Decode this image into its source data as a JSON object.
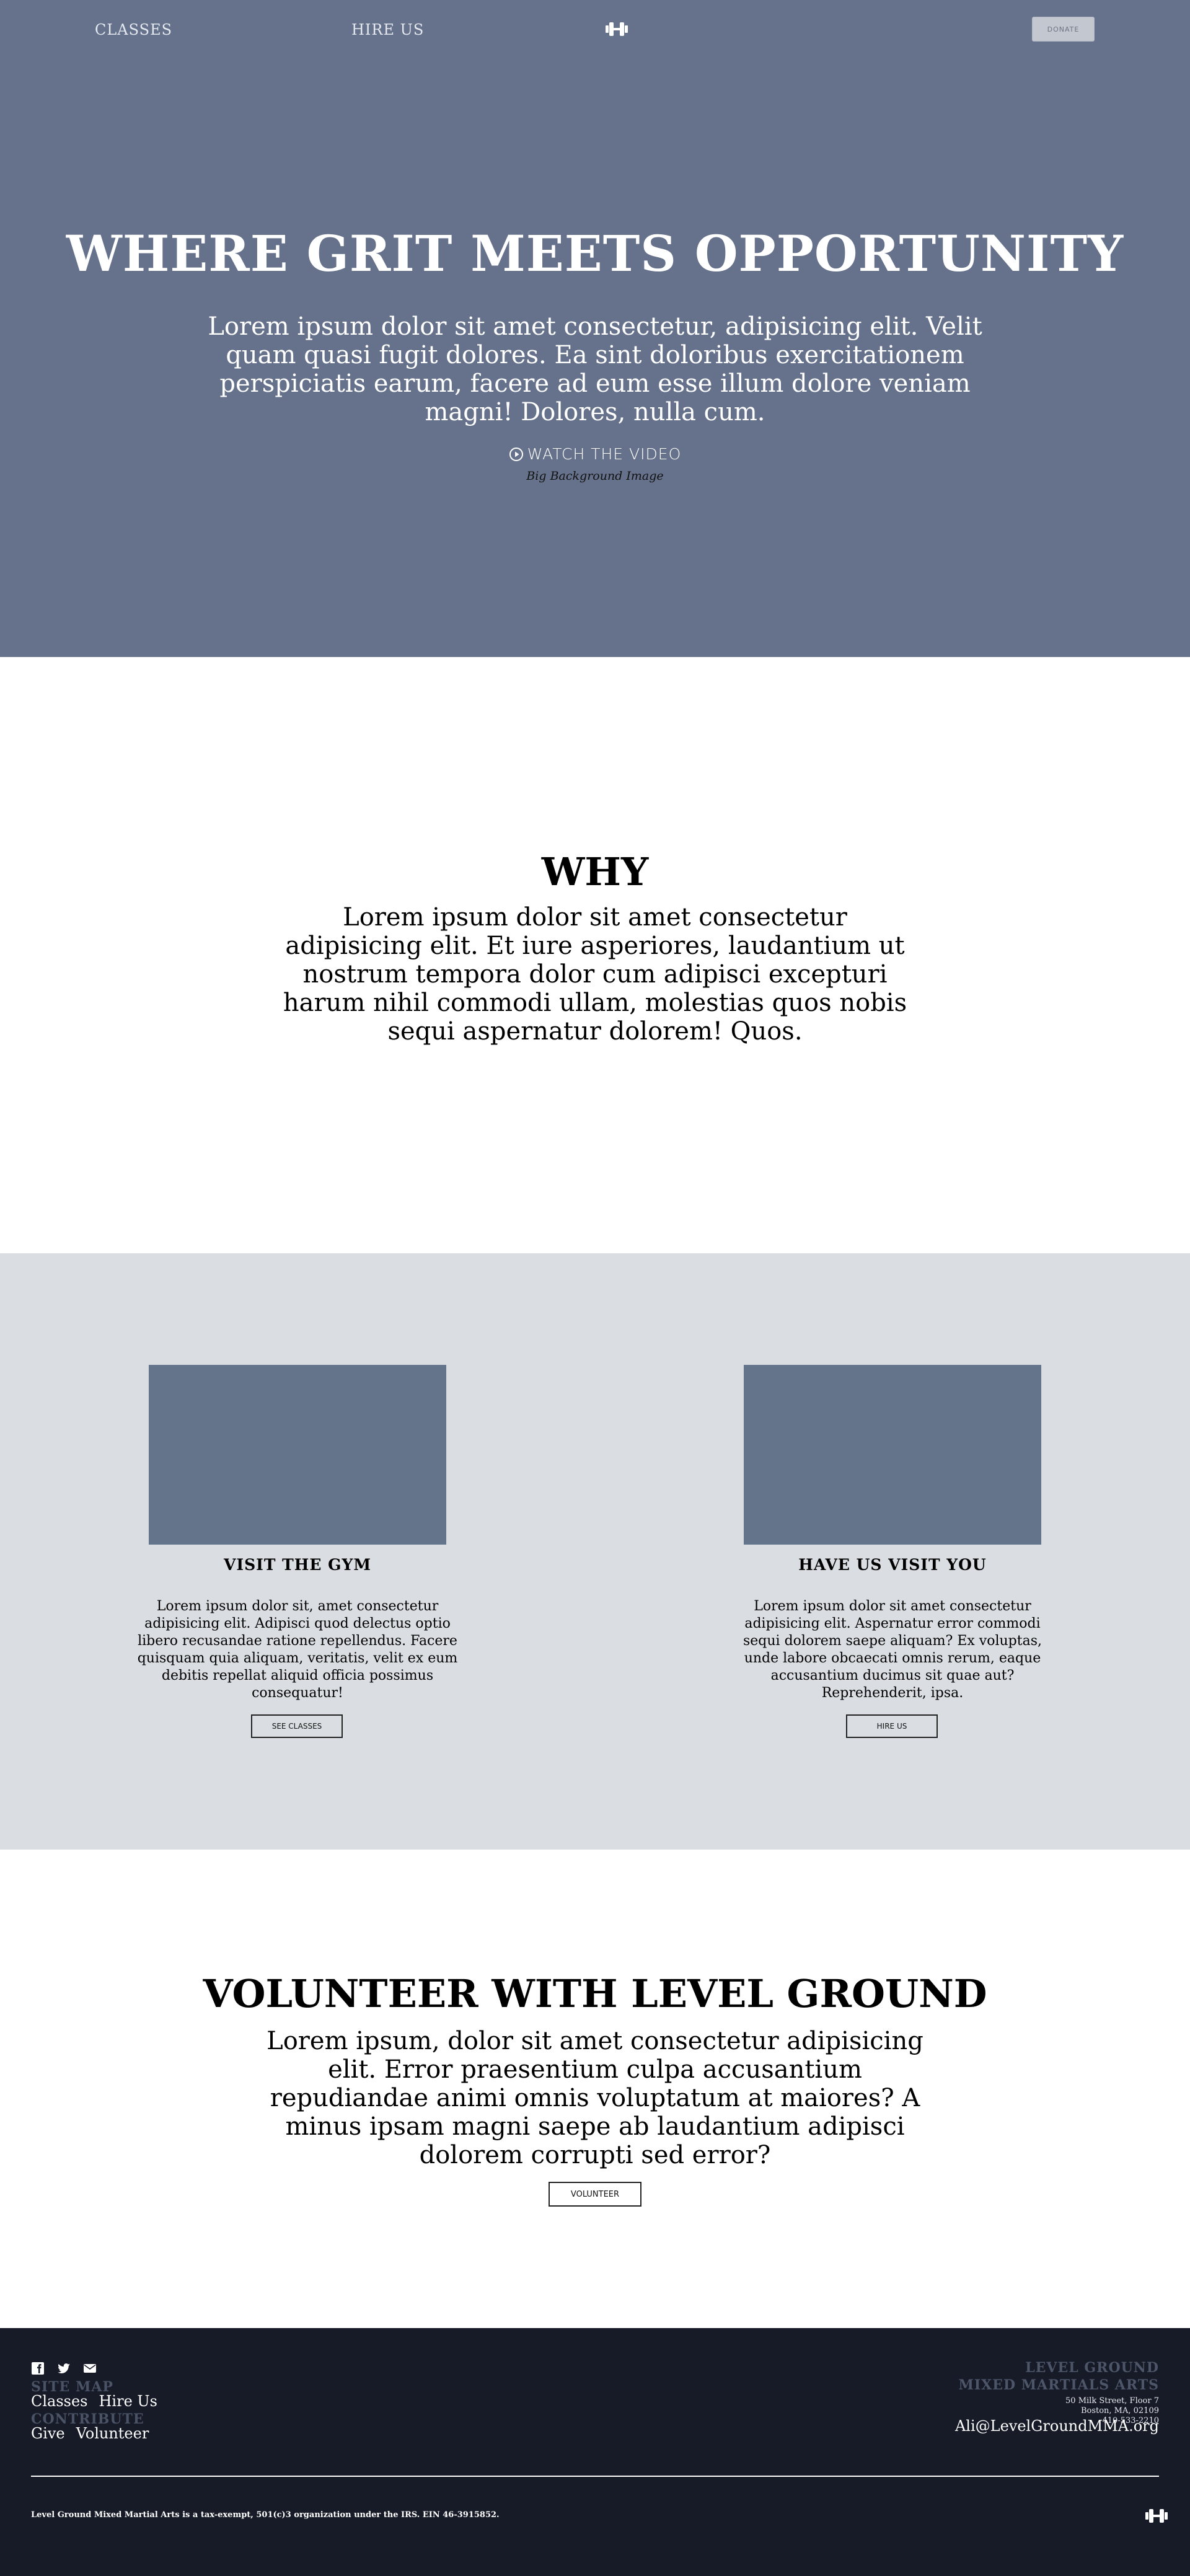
{
  "nav": {
    "classes": "CLASSES",
    "hire_us": "HIRE US",
    "donate": "DONATE",
    "logo_icon": "dumbbell-icon"
  },
  "hero": {
    "title": "WHERE GRIT MEETS OPPORTUNITY",
    "text": "Lorem ipsum dolor sit amet consectetur, adipisicing elit. Velit quam quasi fugit dolores. Ea sint doloribus exercitationem perspiciatis earum, facere ad eum esse illum dolore veniam magni! Dolores, nulla cum.",
    "watch_video": "WATCH THE VIDEO",
    "caption": "Big Background Image",
    "background_color": "#66728b"
  },
  "why": {
    "title": "WHY",
    "text": "Lorem ipsum dolor sit amet consectetur adipisicing elit. Et iure asperiores, laudantium ut nostrum tempora dolor cum adipisci excepturi harum nihil commodi ullam, molestias quos nobis sequi aspernatur dolorem! Quos."
  },
  "cards": [
    {
      "title": "VISIT THE GYM",
      "text": "Lorem ipsum dolor sit, amet consectetur adipisicing elit. Adipisci quod delectus optio libero recusandae ratione repellendus. Facere quisquam quia aliquam, veritatis, velit ex eum debitis repellat aliquid officia possimus consequatur!",
      "button": "SEE CLASSES"
    },
    {
      "title": "HAVE US VISIT YOU",
      "text": "Lorem ipsum dolor sit amet consectetur adipisicing elit. Aspernatur error commodi sequi dolorem saepe aliquam? Ex voluptas, unde labore obcaecati omnis rerum, eaque accusantium ducimus sit quae aut? Reprehenderit, ipsa.",
      "button": "HIRE US"
    }
  ],
  "volunteer": {
    "title": "VOLUNTEER WITH LEVEL GROUND",
    "text": "Lorem ipsum, dolor sit amet consectetur adipisicing elit. Error praesentium culpa accusantium repudiandae animi omnis voluptatum at maiores? A minus ipsam magni saepe ab laudantium adipisci dolorem corrupti sed error?",
    "button": "VOLUNTEER"
  },
  "footer": {
    "social_icons": [
      "facebook-icon",
      "twitter-icon",
      "email-icon"
    ],
    "site_map_heading": "SITE MAP",
    "site_map_links": [
      "Classes",
      "Hire Us"
    ],
    "contribute_heading": "CONTRIBUTE",
    "contribute_links": [
      "Give",
      "Volunteer"
    ],
    "org_line1": "LEVEL GROUND",
    "org_line2": "MIXED MARTIALS ARTS",
    "address_line1": "50 Milk Street, Floor 7",
    "address_line2": "Boston, MA, 02109",
    "phone": "410-533-2210",
    "email": "Ali@LevelGroundMMA.org",
    "legal": "Level Ground Mixed Martial Arts is a tax-exempt, 501(c)3 organization under the IRS. EIN 46-3915852.",
    "background_color": "#171b28"
  }
}
